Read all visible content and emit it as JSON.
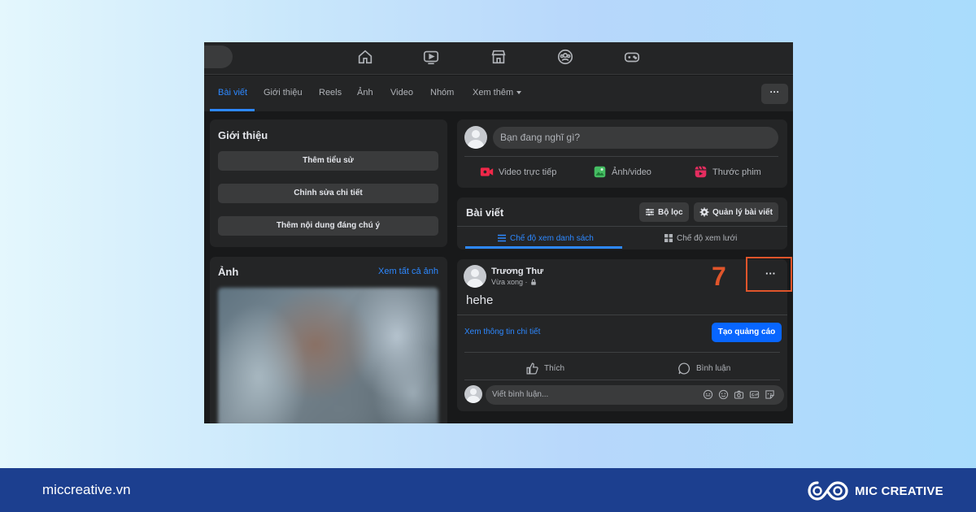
{
  "colors": {
    "accent": "#2d88ff",
    "annotation": "#e0552b",
    "footer_bg": "#1c3f8f",
    "primary_button": "#0866ff"
  },
  "top_nav": {
    "icons": [
      "home-icon",
      "video-icon",
      "marketplace-icon",
      "groups-icon",
      "gaming-icon"
    ]
  },
  "tabs": [
    {
      "label": "Bài viết",
      "active": true
    },
    {
      "label": "Giới thiệu"
    },
    {
      "label": "Reels"
    },
    {
      "label": "Ảnh"
    },
    {
      "label": "Video"
    },
    {
      "label": "Nhóm"
    },
    {
      "label": "Xem thêm"
    }
  ],
  "more_button": "···",
  "intro": {
    "title": "Giới thiệu",
    "buttons": [
      "Thêm tiểu sử",
      "Chỉnh sửa chi tiết",
      "Thêm nội dung đáng chú ý"
    ]
  },
  "photos": {
    "title": "Ảnh",
    "see_all": "Xem tất cả ảnh"
  },
  "composer": {
    "placeholder": "Bạn đang nghĩ gì?",
    "actions": [
      "Video trực tiếp",
      "Ảnh/video",
      "Thước phim"
    ]
  },
  "posts_header": {
    "title": "Bài viết",
    "filter": "Bộ lọc",
    "manage": "Quản lý bài viết",
    "view_list": "Chế độ xem danh sách",
    "view_grid": "Chế độ xem lưới"
  },
  "post": {
    "author": "Trương Thư",
    "time": "Vừa xong ·",
    "text": "hehe",
    "menu": "···",
    "info_link": "Xem thông tin chi tiết",
    "ad_button": "Tạo quảng cáo",
    "like": "Thích",
    "comment": "Bình luận",
    "comment_placeholder": "Viết bình luận..."
  },
  "annotation": {
    "step": "7"
  },
  "footer": {
    "url": "miccreative.vn",
    "brand": "MIC CREATIVE"
  }
}
